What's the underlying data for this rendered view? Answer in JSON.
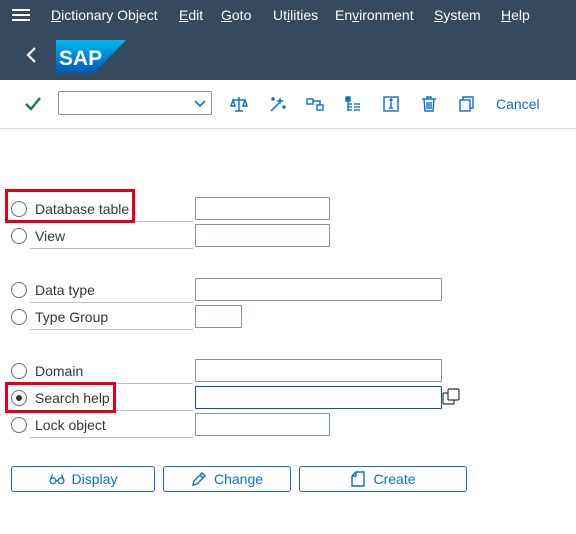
{
  "menubar": {
    "items": [
      "Dictionary Object",
      "Edit",
      "Goto",
      "Utilities",
      "Environment",
      "System",
      "Help"
    ],
    "underlined": [
      "D",
      "E",
      "G",
      "i",
      "v",
      "S",
      "H"
    ]
  },
  "shell": {
    "logo_text": "SAP"
  },
  "toolbar": {
    "command_value": "",
    "icons": [
      "enter-icon",
      "where-used-icon",
      "activate-icon",
      "check-icon",
      "hierarchy-icon",
      "info-icon",
      "delete-icon",
      "copy-icon"
    ],
    "cancel_label": "Cancel"
  },
  "form": {
    "options": [
      {
        "label": "Database table",
        "selected": false,
        "field_value": ""
      },
      {
        "label": "View",
        "selected": false,
        "field_value": ""
      },
      {
        "label": "Data type",
        "selected": false,
        "field_value": ""
      },
      {
        "label": "Type Group",
        "selected": false,
        "field_value": ""
      },
      {
        "label": "Domain",
        "selected": false,
        "field_value": ""
      },
      {
        "label": "Search help",
        "selected": true,
        "field_value": ""
      },
      {
        "label": "Lock object",
        "selected": false,
        "field_value": ""
      }
    ]
  },
  "buttons": {
    "display": "Display",
    "change": "Change",
    "create": "Create"
  },
  "colors": {
    "shell_bg": "#354a5f",
    "accent": "#0a6ed1",
    "highlight": "#e0001a",
    "check": "#107e3e"
  }
}
